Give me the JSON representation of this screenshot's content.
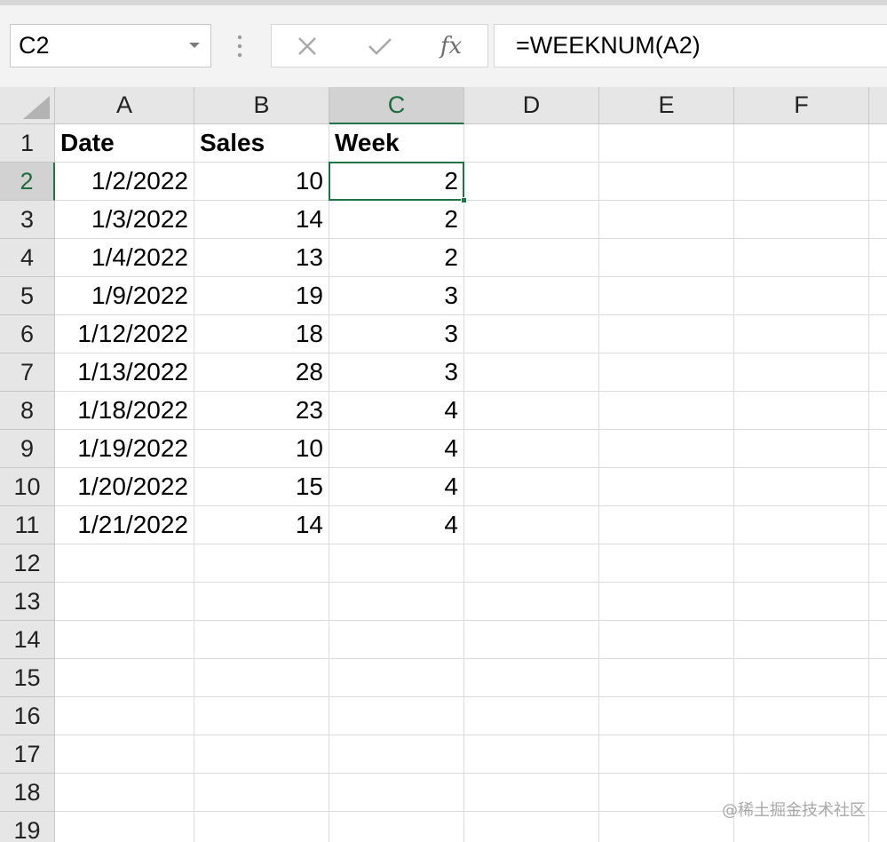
{
  "name_box": {
    "value": "C2"
  },
  "formula_bar": {
    "value": "=WEEKNUM(A2)",
    "fx_label": "fx"
  },
  "columns": [
    "A",
    "B",
    "C",
    "D",
    "E",
    "F"
  ],
  "selected_column": "C",
  "rows": [
    "1",
    "2",
    "3",
    "4",
    "5",
    "6",
    "7",
    "8",
    "9",
    "10",
    "11",
    "12",
    "13",
    "14",
    "15",
    "16",
    "17",
    "18",
    "19"
  ],
  "selected_row": "2",
  "cells": {
    "headers": [
      "Date",
      "Sales",
      "Week"
    ],
    "data": [
      [
        "1/2/2022",
        "10",
        "2"
      ],
      [
        "1/3/2022",
        "14",
        "2"
      ],
      [
        "1/4/2022",
        "13",
        "2"
      ],
      [
        "1/9/2022",
        "19",
        "3"
      ],
      [
        "1/12/2022",
        "18",
        "3"
      ],
      [
        "1/13/2022",
        "28",
        "3"
      ],
      [
        "1/18/2022",
        "23",
        "4"
      ],
      [
        "1/19/2022",
        "10",
        "4"
      ],
      [
        "1/20/2022",
        "15",
        "4"
      ],
      [
        "1/21/2022",
        "14",
        "4"
      ]
    ]
  },
  "colors": {
    "accent": "#217346",
    "header_bg": "#e6e6e6",
    "gridline": "#dcdcdc"
  },
  "watermark": "@稀土掘金技术社区"
}
